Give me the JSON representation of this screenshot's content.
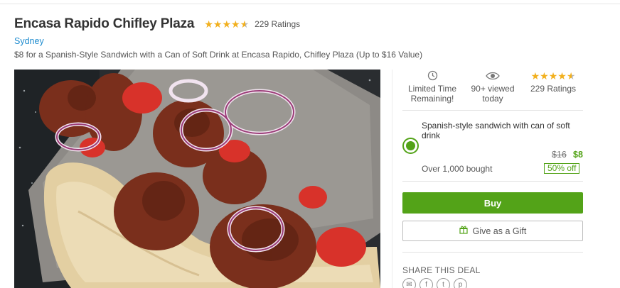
{
  "deal": {
    "title": "Encasa Rapido Chifley Plaza",
    "rating_value": 4.5,
    "rating_count_label": "229 Ratings",
    "city": "Sydney",
    "subtitle": "$8 for a Spanish-Style Sandwich with a Can of Soft Drink at Encasa Rapido, Chifley Plaza (Up to $16 Value)"
  },
  "stats": [
    {
      "icon": "clock-icon",
      "label_line1": "Limited Time",
      "label_line2": "Remaining!"
    },
    {
      "icon": "eye-icon",
      "label_line1": "90+ viewed",
      "label_line2": "today"
    },
    {
      "icon": "stars",
      "label_line1": "229 Ratings",
      "label_line2": ""
    }
  ],
  "option": {
    "name": "Spanish-style sandwich with can of soft drink",
    "old_price": "$16",
    "new_price": "$8",
    "bought": "Over 1,000 bought",
    "discount": "50% off"
  },
  "buttons": {
    "buy": "Buy",
    "gift": "Give as a Gift"
  },
  "share": {
    "title": "SHARE THIS DEAL",
    "icons": [
      "mail-icon",
      "facebook-icon",
      "twitter-icon",
      "pinterest-icon"
    ]
  },
  "colors": {
    "accent_green": "#53a318",
    "link_blue": "#1f8ccf",
    "star_gold": "#f2b01e"
  }
}
